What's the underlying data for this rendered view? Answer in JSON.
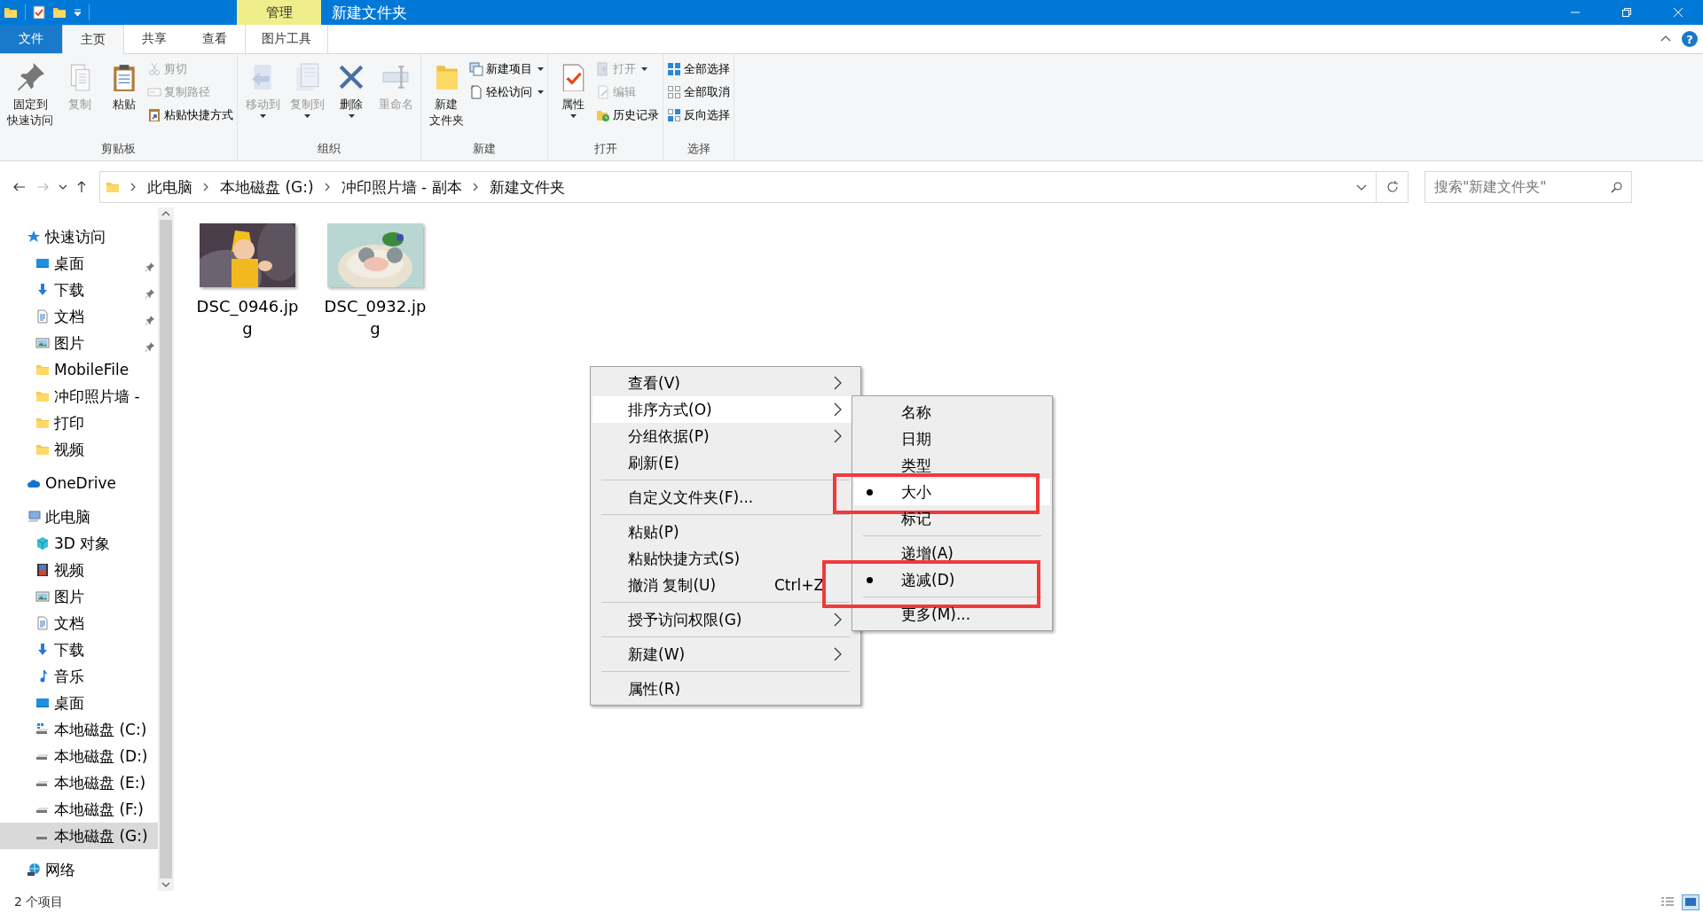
{
  "window": {
    "title": "新建文件夹",
    "context_tab": "管理",
    "help": "?"
  },
  "ribbon_tabs": [
    {
      "label": "文件",
      "kind": "file",
      "selected": false
    },
    {
      "label": "主页",
      "kind": "tab",
      "selected": true
    },
    {
      "label": "共享",
      "kind": "tab",
      "selected": false
    },
    {
      "label": "查看",
      "kind": "tab",
      "selected": false
    },
    {
      "label": "图片工具",
      "kind": "tab",
      "selected": false
    }
  ],
  "ribbon_groups": [
    {
      "label": "剪贴板",
      "commands": [
        {
          "lines": [
            "固定到",
            "快速访问"
          ],
          "kind": "large",
          "disabled": false,
          "dropdown": false
        },
        {
          "lines": [
            "复制"
          ],
          "kind": "large",
          "disabled": true,
          "dropdown": false
        },
        {
          "lines": [
            "粘贴"
          ],
          "kind": "large",
          "disabled": false,
          "dropdown": false
        },
        {
          "lines": [
            "剪切"
          ],
          "kind": "small",
          "disabled": true,
          "dropdown": false
        },
        {
          "lines": [
            "复制路径"
          ],
          "kind": "small",
          "disabled": true,
          "dropdown": false
        },
        {
          "lines": [
            "粘贴快捷方式"
          ],
          "kind": "small",
          "disabled": false,
          "dropdown": false
        }
      ]
    },
    {
      "label": "组织",
      "commands": [
        {
          "lines": [
            "移动到"
          ],
          "kind": "large",
          "disabled": true,
          "dropdown": true
        },
        {
          "lines": [
            "复制到"
          ],
          "kind": "large",
          "disabled": true,
          "dropdown": true
        },
        {
          "lines": [
            "删除"
          ],
          "kind": "large",
          "disabled": false,
          "dropdown": true
        },
        {
          "lines": [
            "重命名"
          ],
          "kind": "large",
          "disabled": true,
          "dropdown": false
        }
      ]
    },
    {
      "label": "新建",
      "commands": [
        {
          "lines": [
            "新建",
            "文件夹"
          ],
          "kind": "large",
          "disabled": false,
          "dropdown": false
        },
        {
          "lines": [
            "新建项目"
          ],
          "kind": "small",
          "disabled": false,
          "dropdown": true
        },
        {
          "lines": [
            "轻松访问"
          ],
          "kind": "small",
          "disabled": false,
          "dropdown": true
        }
      ]
    },
    {
      "label": "打开",
      "commands": [
        {
          "lines": [
            "属性"
          ],
          "kind": "large",
          "disabled": false,
          "dropdown": true
        },
        {
          "lines": [
            "打开"
          ],
          "kind": "small",
          "disabled": true,
          "dropdown": true
        },
        {
          "lines": [
            "编辑"
          ],
          "kind": "small",
          "disabled": true,
          "dropdown": false
        },
        {
          "lines": [
            "历史记录"
          ],
          "kind": "small",
          "disabled": false,
          "dropdown": false
        }
      ]
    },
    {
      "label": "选择",
      "commands": [
        {
          "lines": [
            "全部选择"
          ],
          "kind": "small",
          "disabled": false,
          "dropdown": false
        },
        {
          "lines": [
            "全部取消"
          ],
          "kind": "small",
          "disabled": false,
          "dropdown": false
        },
        {
          "lines": [
            "反向选择"
          ],
          "kind": "small",
          "disabled": false,
          "dropdown": false
        }
      ]
    }
  ],
  "address": {
    "breadcrumbs": [
      "此电脑",
      "本地磁盘 (G:)",
      "冲印照片墙 - 副本",
      "新建文件夹"
    ],
    "search_placeholder": "搜索\"新建文件夹\""
  },
  "sidebar": {
    "items": [
      {
        "label": "快速访问",
        "selected": false,
        "children": [
          {
            "label": "桌面",
            "selected": false,
            "pinned": true
          },
          {
            "label": "下载",
            "selected": false,
            "pinned": true
          },
          {
            "label": "文档",
            "selected": false,
            "pinned": true
          },
          {
            "label": "图片",
            "selected": false,
            "pinned": true
          },
          {
            "label": "MobileFile",
            "selected": false,
            "pinned": false
          },
          {
            "label": "冲印照片墙 -",
            "selected": false,
            "pinned": false
          },
          {
            "label": "打印",
            "selected": false,
            "pinned": false
          },
          {
            "label": "视频",
            "selected": false,
            "pinned": false
          }
        ]
      },
      {
        "label": "OneDrive",
        "selected": false
      },
      {
        "label": "此电脑",
        "selected": false,
        "children": [
          {
            "label": "3D 对象",
            "selected": false
          },
          {
            "label": "视频",
            "selected": false
          },
          {
            "label": "图片",
            "selected": false
          },
          {
            "label": "文档",
            "selected": false
          },
          {
            "label": "下载",
            "selected": false
          },
          {
            "label": "音乐",
            "selected": false
          },
          {
            "label": "桌面",
            "selected": false
          },
          {
            "label": "本地磁盘 (C:)",
            "selected": false
          },
          {
            "label": "本地磁盘 (D:)",
            "selected": false
          },
          {
            "label": "本地磁盘 (E:)",
            "selected": false
          },
          {
            "label": "本地磁盘 (F:)",
            "selected": false
          },
          {
            "label": "本地磁盘 (G:)",
            "selected": true
          }
        ]
      },
      {
        "label": "网络",
        "selected": false
      }
    ]
  },
  "files": [
    {
      "name": "DSC_0946.jpg",
      "kind": "picture"
    },
    {
      "name": "DSC_0932.jpg",
      "kind": "picture"
    }
  ],
  "context_menu": {
    "items": [
      {
        "kind": "item",
        "label": "查看(V)",
        "submenu": true,
        "selected": false
      },
      {
        "kind": "item",
        "label": "排序方式(O)",
        "submenu": true,
        "selected": true
      },
      {
        "kind": "item",
        "label": "分组依据(P)",
        "submenu": true,
        "selected": false
      },
      {
        "kind": "item",
        "label": "刷新(E)",
        "submenu": false,
        "selected": false
      },
      {
        "kind": "separator"
      },
      {
        "kind": "item",
        "label": "自定义文件夹(F)...",
        "submenu": false,
        "selected": false
      },
      {
        "kind": "separator"
      },
      {
        "kind": "item",
        "label": "粘贴(P)",
        "submenu": false,
        "selected": false
      },
      {
        "kind": "item",
        "label": "粘贴快捷方式(S)",
        "submenu": false,
        "selected": false
      },
      {
        "kind": "item",
        "label": "撤消 复制(U)",
        "shortcut": "Ctrl+Z",
        "submenu": false,
        "selected": false
      },
      {
        "kind": "separator"
      },
      {
        "kind": "item",
        "label": "授予访问权限(G)",
        "submenu": true,
        "selected": false
      },
      {
        "kind": "separator"
      },
      {
        "kind": "item",
        "label": "新建(W)",
        "submenu": true,
        "selected": false
      },
      {
        "kind": "separator"
      },
      {
        "kind": "item",
        "label": "属性(R)",
        "submenu": false,
        "selected": false
      }
    ]
  },
  "sort_menu": {
    "items": [
      {
        "kind": "item",
        "label": "名称",
        "checked": false,
        "selected": false,
        "annotated": false
      },
      {
        "kind": "item",
        "label": "日期",
        "checked": false,
        "selected": false,
        "annotated": false
      },
      {
        "kind": "item",
        "label": "类型",
        "checked": false,
        "selected": false,
        "annotated": false
      },
      {
        "kind": "item",
        "label": "大小",
        "checked": true,
        "selected": true,
        "annotated": true
      },
      {
        "kind": "item",
        "label": "标记",
        "checked": false,
        "selected": false,
        "annotated": false
      },
      {
        "kind": "separator"
      },
      {
        "kind": "item",
        "label": "递增(A)",
        "checked": false,
        "selected": false,
        "annotated": false
      },
      {
        "kind": "item",
        "label": "递减(D)",
        "checked": true,
        "selected": false,
        "annotated": true
      },
      {
        "kind": "separator"
      },
      {
        "kind": "item",
        "label": "更多(M)...",
        "checked": false,
        "selected": false,
        "annotated": false
      }
    ]
  },
  "status_bar": {
    "text": "2 个项目"
  }
}
